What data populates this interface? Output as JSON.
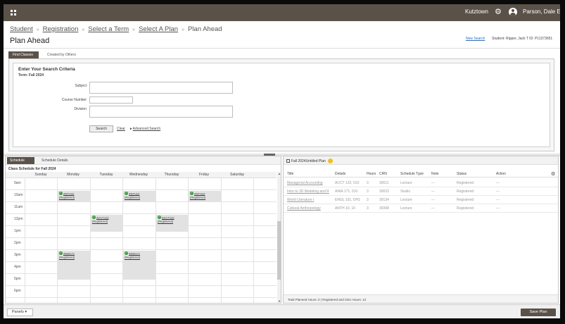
{
  "topbar": {
    "institution": "Kutztown",
    "user_name": "Parson, Dale E",
    "icons": [
      "apps-grid-icon",
      "gear-icon",
      "user-avatar-icon"
    ]
  },
  "breadcrumbs": [
    "Student",
    "Registration",
    "Select a Term",
    "Select A Plan",
    "Plan Ahead"
  ],
  "page": {
    "title": "Plan Ahead",
    "new_search": "New Search",
    "student_info": "Student: Ripper, Jack T   ID: P11373651"
  },
  "tabs": {
    "find_classes": "Find Classes",
    "created_by_others": "Created by Others"
  },
  "search": {
    "title": "Enter Your Search Criteria",
    "term": "Term: Fall 2024",
    "subject_label": "Subject",
    "subject_value": "",
    "course_number_label": "Course Number",
    "course_number_value": "",
    "division_label": "Division",
    "division_value": "",
    "search_button": "Search",
    "clear_link": "Clear",
    "advanced_link": "Advanced Search",
    "advanced_marker": "▸"
  },
  "schedule": {
    "tab_schedule": "Schedule",
    "tab_details": "Schedule Details",
    "title": "Class Schedule for Fall 2024",
    "days": [
      "Sunday",
      "Monday",
      "Tuesday",
      "Wednesday",
      "Thursday",
      "Friday",
      "Saturday"
    ],
    "hours": [
      "9am",
      "10am",
      "11am",
      "12pm",
      "1pm",
      "2pm",
      "3pm",
      "4pm",
      "5pm",
      "6pm"
    ],
    "events": [
      {
        "label": "ANTH10 (Registered)",
        "day": 1,
        "start": 1,
        "span": 1
      },
      {
        "label": "ANTH10 (Registered)",
        "day": 3,
        "start": 1,
        "span": 1
      },
      {
        "label": "ANTH10 (Registered)",
        "day": 5,
        "start": 1,
        "span": 1
      },
      {
        "label": "ACCT122 (Registered)",
        "day": 2,
        "start": 3,
        "span": 1.5
      },
      {
        "label": "ACCT122 (Registered)",
        "day": 4,
        "start": 3,
        "span": 1.5
      },
      {
        "label": "ANIA171 (Registered)",
        "day": 1,
        "start": 6,
        "span": 2.5
      },
      {
        "label": "ANIA171 (Registered)",
        "day": 3,
        "start": 6,
        "span": 2.5
      }
    ]
  },
  "plan": {
    "title": "Fall 2024Untitled Plan",
    "columns": [
      "Title",
      "Details",
      "Hours",
      "CRN",
      "Schedule Type",
      "Note",
      "Status",
      "Action"
    ],
    "rows": [
      [
        "Managerial Accounting",
        "ACCT 122, 010",
        "3",
        "30011",
        "Lecture",
        "---",
        "Registered",
        "---"
      ],
      [
        "Intro to 3D Modeling and R",
        "ANIA 171, 010",
        "3",
        "30023",
        "Studio",
        "---",
        "Registered",
        "---"
      ],
      [
        "World Literature I",
        "ENGL 101, DH1",
        "3",
        "30134",
        "Lecture",
        "---",
        "Registered",
        "---"
      ],
      [
        "Cultural Anthropology",
        "ANTH 10, 10",
        "3",
        "30398",
        "Lecture",
        "---",
        "Registered",
        "---"
      ]
    ],
    "footer": "Total Planned Hours: 0 | Registered and CEU Hours: 12"
  },
  "bottom": {
    "panels": "Panels ▾",
    "save_plan": "Save Plan"
  }
}
